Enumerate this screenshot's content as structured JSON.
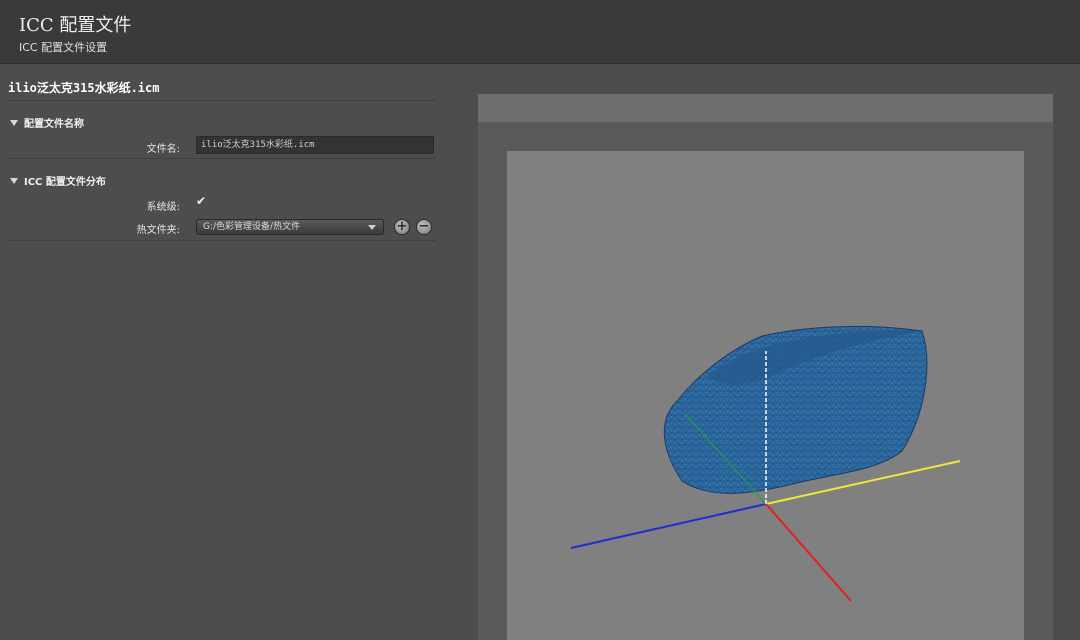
{
  "header": {
    "title": "ICC 配置文件",
    "subtitle": "ICC 配置文件设置"
  },
  "profile": {
    "filename_heading": "ilio泛太克315水彩纸.icm"
  },
  "section_name": {
    "title": "配置文件名称",
    "file_label": "文件名:",
    "file_value": "ilio泛太克315水彩纸.icm"
  },
  "section_distribution": {
    "title": "ICC 配置文件分布",
    "system_label": "系统级:",
    "system_checked": true,
    "folder_label": "热文件夹:",
    "folder_value": "G:/色彩管理设备/热文件",
    "add_button": "+",
    "remove_button": "−"
  },
  "viewer": {
    "axis_colors": {
      "blue": "#1f2fd0",
      "yellow": "#f0e63a",
      "red": "#e02020",
      "green": "#20a040",
      "white": "#ffffff"
    },
    "gamut_color": "#2f6fa8",
    "mesh_color": "#1a3c66"
  }
}
